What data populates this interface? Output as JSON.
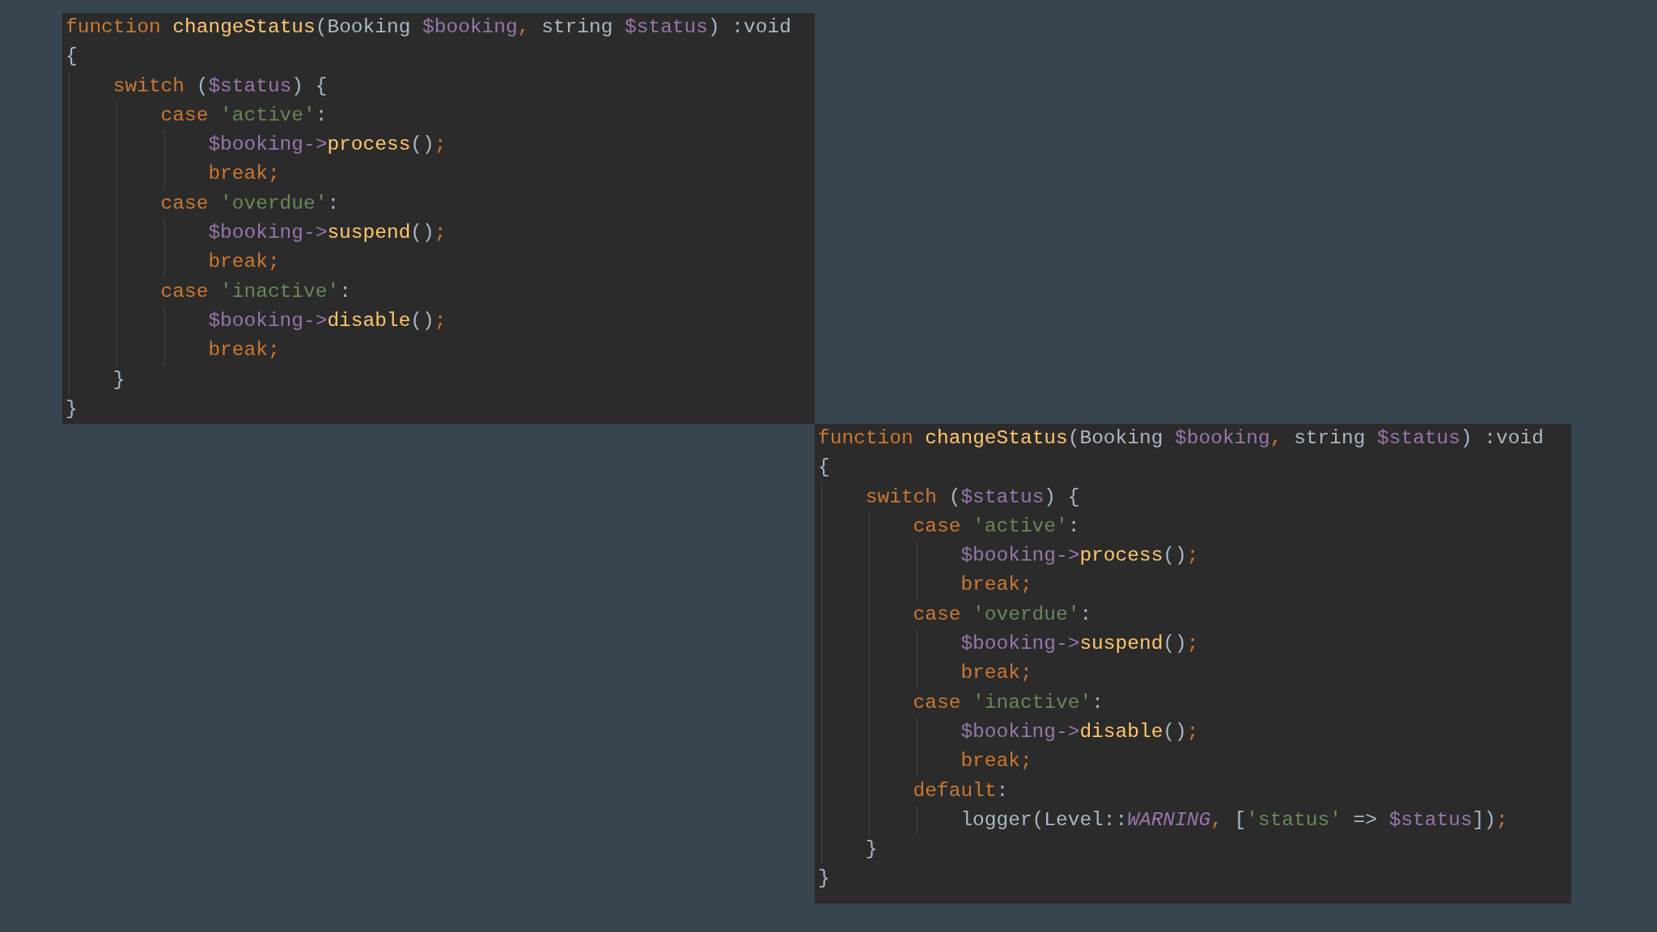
{
  "panels": [
    {
      "lines": [
        {
          "tokens": [
            {
              "kind": "keyword",
              "text": "function "
            },
            {
              "kind": "function",
              "text": "changeStatus"
            },
            {
              "kind": "plain",
              "text": "(Booking "
            },
            {
              "kind": "variable",
              "text": "$booking"
            },
            {
              "kind": "keyword",
              "text": ", "
            },
            {
              "kind": "plain",
              "text": "string "
            },
            {
              "kind": "variable",
              "text": "$status"
            },
            {
              "kind": "plain",
              "text": ") :void"
            }
          ]
        },
        {
          "tokens": [
            {
              "kind": "plain",
              "text": "{"
            }
          ]
        },
        {
          "children": [
            {
              "tokens": [
                {
                  "kind": "keyword",
                  "text": "switch "
                },
                {
                  "kind": "plain",
                  "text": "("
                },
                {
                  "kind": "variable",
                  "text": "$status"
                },
                {
                  "kind": "plain",
                  "text": ") {"
                }
              ]
            },
            {
              "children": [
                {
                  "tokens": [
                    {
                      "kind": "keyword",
                      "text": "case "
                    },
                    {
                      "kind": "string",
                      "text": "'active'"
                    },
                    {
                      "kind": "plain",
                      "text": ":"
                    }
                  ]
                },
                {
                  "children": [
                    {
                      "tokens": [
                        {
                          "kind": "variable",
                          "text": "$booking->"
                        },
                        {
                          "kind": "function",
                          "text": "process"
                        },
                        {
                          "kind": "plain",
                          "text": "()"
                        },
                        {
                          "kind": "keyword",
                          "text": ";"
                        }
                      ]
                    },
                    {
                      "tokens": [
                        {
                          "kind": "keyword",
                          "text": "break;"
                        }
                      ]
                    }
                  ]
                },
                {
                  "tokens": [
                    {
                      "kind": "keyword",
                      "text": "case "
                    },
                    {
                      "kind": "string",
                      "text": "'overdue'"
                    },
                    {
                      "kind": "plain",
                      "text": ":"
                    }
                  ]
                },
                {
                  "children": [
                    {
                      "tokens": [
                        {
                          "kind": "variable",
                          "text": "$booking->"
                        },
                        {
                          "kind": "function",
                          "text": "suspend"
                        },
                        {
                          "kind": "plain",
                          "text": "()"
                        },
                        {
                          "kind": "keyword",
                          "text": ";"
                        }
                      ]
                    },
                    {
                      "tokens": [
                        {
                          "kind": "keyword",
                          "text": "break;"
                        }
                      ]
                    }
                  ]
                },
                {
                  "tokens": [
                    {
                      "kind": "keyword",
                      "text": "case "
                    },
                    {
                      "kind": "string",
                      "text": "'inactive'"
                    },
                    {
                      "kind": "plain",
                      "text": ":"
                    }
                  ]
                },
                {
                  "children": [
                    {
                      "tokens": [
                        {
                          "kind": "variable",
                          "text": "$booking->"
                        },
                        {
                          "kind": "function",
                          "text": "disable"
                        },
                        {
                          "kind": "plain",
                          "text": "()"
                        },
                        {
                          "kind": "keyword",
                          "text": ";"
                        }
                      ]
                    },
                    {
                      "tokens": [
                        {
                          "kind": "keyword",
                          "text": "break;"
                        }
                      ]
                    }
                  ]
                }
              ]
            },
            {
              "tokens": [
                {
                  "kind": "plain",
                  "text": "}"
                }
              ]
            }
          ]
        },
        {
          "tokens": [
            {
              "kind": "plain",
              "text": "}"
            }
          ]
        }
      ]
    },
    {
      "lines": [
        {
          "tokens": [
            {
              "kind": "keyword",
              "text": "function "
            },
            {
              "kind": "function",
              "text": "changeStatus"
            },
            {
              "kind": "plain",
              "text": "(Booking "
            },
            {
              "kind": "variable",
              "text": "$booking"
            },
            {
              "kind": "keyword",
              "text": ", "
            },
            {
              "kind": "plain",
              "text": "string "
            },
            {
              "kind": "variable",
              "text": "$status"
            },
            {
              "kind": "plain",
              "text": ") :void"
            }
          ]
        },
        {
          "tokens": [
            {
              "kind": "plain",
              "text": "{"
            }
          ]
        },
        {
          "children": [
            {
              "tokens": [
                {
                  "kind": "keyword",
                  "text": "switch "
                },
                {
                  "kind": "plain",
                  "text": "("
                },
                {
                  "kind": "variable",
                  "text": "$status"
                },
                {
                  "kind": "plain",
                  "text": ") {"
                }
              ]
            },
            {
              "children": [
                {
                  "tokens": [
                    {
                      "kind": "keyword",
                      "text": "case "
                    },
                    {
                      "kind": "string",
                      "text": "'active'"
                    },
                    {
                      "kind": "plain",
                      "text": ":"
                    }
                  ]
                },
                {
                  "children": [
                    {
                      "tokens": [
                        {
                          "kind": "variable",
                          "text": "$booking->"
                        },
                        {
                          "kind": "function",
                          "text": "process"
                        },
                        {
                          "kind": "plain",
                          "text": "()"
                        },
                        {
                          "kind": "keyword",
                          "text": ";"
                        }
                      ]
                    },
                    {
                      "tokens": [
                        {
                          "kind": "keyword",
                          "text": "break;"
                        }
                      ]
                    }
                  ]
                },
                {
                  "tokens": [
                    {
                      "kind": "keyword",
                      "text": "case "
                    },
                    {
                      "kind": "string",
                      "text": "'overdue'"
                    },
                    {
                      "kind": "plain",
                      "text": ":"
                    }
                  ]
                },
                {
                  "children": [
                    {
                      "tokens": [
                        {
                          "kind": "variable",
                          "text": "$booking->"
                        },
                        {
                          "kind": "function",
                          "text": "suspend"
                        },
                        {
                          "kind": "plain",
                          "text": "()"
                        },
                        {
                          "kind": "keyword",
                          "text": ";"
                        }
                      ]
                    },
                    {
                      "tokens": [
                        {
                          "kind": "keyword",
                          "text": "break;"
                        }
                      ]
                    }
                  ]
                },
                {
                  "tokens": [
                    {
                      "kind": "keyword",
                      "text": "case "
                    },
                    {
                      "kind": "string",
                      "text": "'inactive'"
                    },
                    {
                      "kind": "plain",
                      "text": ":"
                    }
                  ]
                },
                {
                  "children": [
                    {
                      "tokens": [
                        {
                          "kind": "variable",
                          "text": "$booking->"
                        },
                        {
                          "kind": "function",
                          "text": "disable"
                        },
                        {
                          "kind": "plain",
                          "text": "()"
                        },
                        {
                          "kind": "keyword",
                          "text": ";"
                        }
                      ]
                    },
                    {
                      "tokens": [
                        {
                          "kind": "keyword",
                          "text": "break;"
                        }
                      ]
                    }
                  ]
                },
                {
                  "tokens": [
                    {
                      "kind": "keyword",
                      "text": "default"
                    },
                    {
                      "kind": "plain",
                      "text": ":"
                    }
                  ]
                },
                {
                  "children": [
                    {
                      "tokens": [
                        {
                          "kind": "plain",
                          "text": "logger(Level::"
                        },
                        {
                          "kind": "constant",
                          "text": "WARNING"
                        },
                        {
                          "kind": "keyword",
                          "text": ", "
                        },
                        {
                          "kind": "plain",
                          "text": "["
                        },
                        {
                          "kind": "string",
                          "text": "'status'"
                        },
                        {
                          "kind": "plain",
                          "text": " => "
                        },
                        {
                          "kind": "variable",
                          "text": "$status"
                        },
                        {
                          "kind": "plain",
                          "text": "])"
                        },
                        {
                          "kind": "keyword",
                          "text": ";"
                        }
                      ]
                    }
                  ]
                }
              ]
            },
            {
              "tokens": [
                {
                  "kind": "plain",
                  "text": "}"
                }
              ]
            }
          ]
        },
        {
          "tokens": [
            {
              "kind": "plain",
              "text": "}"
            }
          ]
        }
      ]
    }
  ]
}
